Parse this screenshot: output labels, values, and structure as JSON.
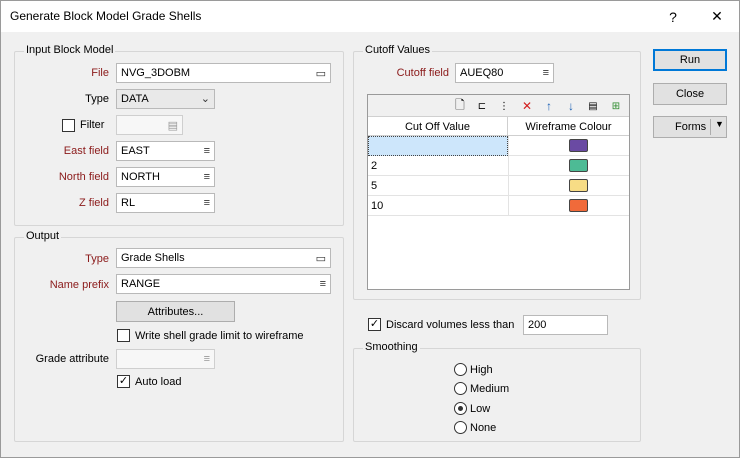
{
  "window": {
    "title": "Generate Block Model Grade Shells",
    "help_label": "?",
    "close_label": "✕"
  },
  "input_block_model": {
    "group_label": "Input Block Model",
    "file_label": "File",
    "file_value": "NVG_3DOBM",
    "type_label": "Type",
    "type_value": "DATA",
    "filter_label": "Filter",
    "filter_checked": false,
    "east_label": "East field",
    "east_value": "EAST",
    "north_label": "North field",
    "north_value": "NORTH",
    "z_label": "Z field",
    "z_value": "RL"
  },
  "output": {
    "group_label": "Output",
    "type_label": "Type",
    "type_value": "Grade Shells",
    "name_prefix_label": "Name prefix",
    "name_prefix_value": "RANGE",
    "attributes_button": "Attributes...",
    "write_limit_label": "Write shell grade limit to wireframe",
    "write_limit_checked": false,
    "grade_attribute_label": "Grade attribute",
    "grade_attribute_value": "",
    "auto_load_label": "Auto load",
    "auto_load_checked": true
  },
  "cutoff_values": {
    "group_label": "Cutoff Values",
    "cutoff_field_label": "Cutoff field",
    "cutoff_field_value": "AUEQ80",
    "columns": [
      "Cut Off Value",
      "Wireframe Colour"
    ],
    "rows": [
      {
        "value": "",
        "colour": "#6a4aa3"
      },
      {
        "value": "2",
        "colour": "#4dbb95"
      },
      {
        "value": "5",
        "colour": "#f7dc85"
      },
      {
        "value": "10",
        "colour": "#f06a3a"
      }
    ]
  },
  "discard": {
    "label": "Discard volumes less than",
    "checked": true,
    "value": "200"
  },
  "smoothing": {
    "group_label": "Smoothing",
    "options": [
      "High",
      "Medium",
      "Low",
      "None"
    ],
    "selected": "Low"
  },
  "buttons": {
    "run": "Run",
    "close": "Close",
    "forms": "Forms"
  },
  "colors": {
    "required_label": "#8b1a1a",
    "accent": "#0078d7"
  }
}
